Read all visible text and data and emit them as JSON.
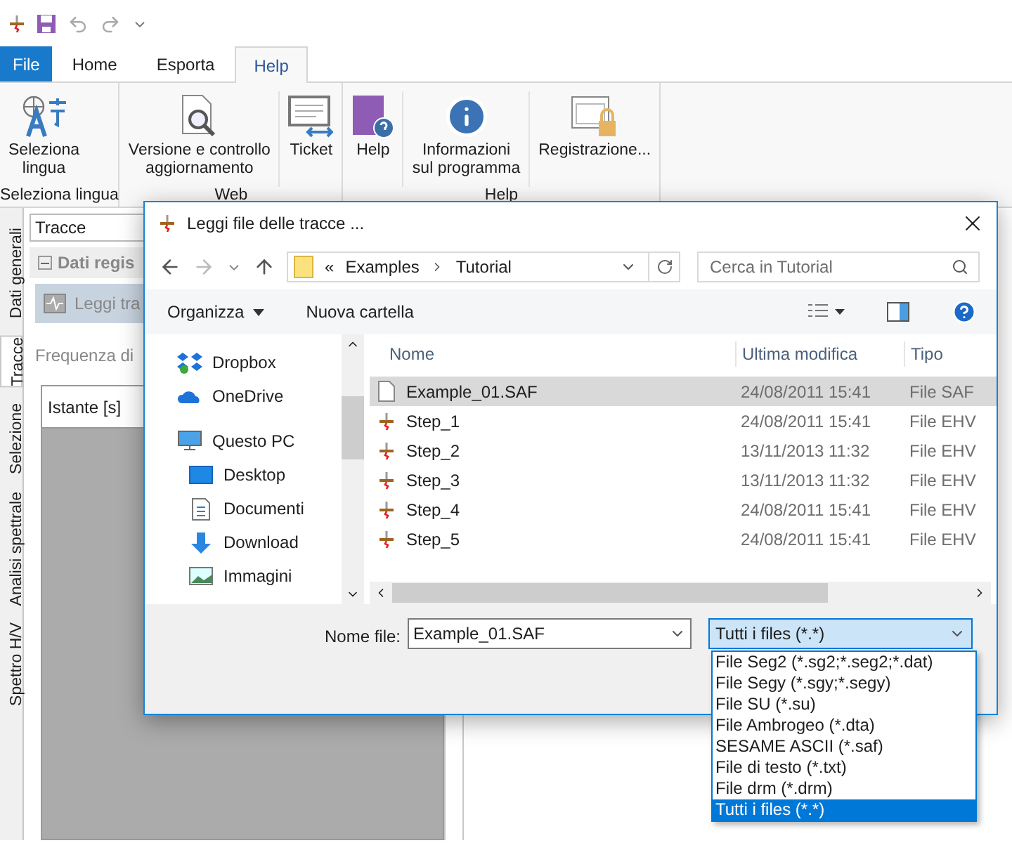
{
  "ribbon_tabs": [
    {
      "label": "File",
      "kind": "file",
      "selected": false
    },
    {
      "label": "Home",
      "kind": "tab",
      "selected": false
    },
    {
      "label": "Esporta",
      "kind": "tab",
      "selected": false
    },
    {
      "label": "Help",
      "kind": "tab",
      "selected": true
    }
  ],
  "ribbon_groups": [
    {
      "label": "Seleziona lingua",
      "buttons": [
        {
          "lines": [
            "Seleziona",
            "lingua"
          ],
          "kind": "language"
        }
      ]
    },
    {
      "label": "Web",
      "buttons": [
        {
          "lines": [
            "Versione e controllo",
            "aggiornamento"
          ],
          "kind": "version"
        },
        {
          "lines": [
            "Ticket"
          ],
          "kind": "ticket"
        }
      ]
    },
    {
      "label": "Help",
      "buttons": [
        {
          "lines": [
            "Help"
          ],
          "kind": "help"
        },
        {
          "lines": [
            "Informazioni",
            "sul programma"
          ],
          "kind": "info"
        },
        {
          "lines": [
            "Registrazione..."
          ],
          "kind": "register"
        }
      ]
    }
  ],
  "side_tabs": [
    {
      "label": "Dati generali",
      "selected": false
    },
    {
      "label": "Tracce",
      "selected": true
    },
    {
      "label": "Selezione",
      "selected": false
    },
    {
      "label": "Analisi spettrale",
      "selected": false
    },
    {
      "label": "Spettro H/V",
      "selected": false
    }
  ],
  "panel": {
    "combo": "Tracce",
    "group": "Dati regis",
    "button": "Leggi tra",
    "field_label": "Frequenza di",
    "column": "Istante [s]"
  },
  "dialog": {
    "title": "Leggi file delle tracce ...",
    "path": [
      "Examples",
      "Tutorial"
    ],
    "path_prefix": "«",
    "search": {
      "placeholder": "Cerca in Tutorial"
    },
    "toolbar": [
      "Organizza",
      "Nuova cartella"
    ],
    "nav": [
      {
        "label": "Dropbox",
        "kind": "dropbox"
      },
      {
        "label": "OneDrive",
        "kind": "onedrive"
      },
      {
        "label": "Questo PC",
        "kind": "pc",
        "children": [
          {
            "label": "Desktop",
            "kind": "desktop"
          },
          {
            "label": "Documenti",
            "kind": "documents"
          },
          {
            "label": "Download",
            "kind": "download"
          },
          {
            "label": "Immagini",
            "kind": "images"
          }
        ]
      }
    ],
    "columns": [
      "Nome",
      "Ultima modifica",
      "Tipo"
    ],
    "files": [
      {
        "name": "Example_01.SAF",
        "modified": "24/08/2011 15:41",
        "type": "File SAF",
        "kind": "document",
        "selected": true
      },
      {
        "name": "Step_1",
        "modified": "24/08/2011 15:41",
        "type": "File EHV",
        "kind": "trace",
        "selected": false
      },
      {
        "name": "Step_2",
        "modified": "13/11/2013 11:32",
        "type": "File EHV",
        "kind": "trace",
        "selected": false
      },
      {
        "name": "Step_3",
        "modified": "13/11/2013 11:32",
        "type": "File EHV",
        "kind": "trace",
        "selected": false
      },
      {
        "name": "Step_4",
        "modified": "24/08/2011 15:41",
        "type": "File EHV",
        "kind": "trace",
        "selected": false
      },
      {
        "name": "Step_5",
        "modified": "24/08/2011 15:41",
        "type": "File EHV",
        "kind": "trace",
        "selected": false
      }
    ],
    "filename_label": "Nome file:",
    "filename": "Example_01.SAF",
    "filetype": "Tutti i files (*.*)",
    "filetype_options": [
      {
        "label": "File Seg2 (*.sg2;*.seg2;*.dat)",
        "selected": false
      },
      {
        "label": "File Segy (*.sgy;*.segy)",
        "selected": false
      },
      {
        "label": "File SU (*.su)",
        "selected": false
      },
      {
        "label": "File Ambrogeo (*.dta)",
        "selected": false
      },
      {
        "label": "SESAME ASCII (*.saf)",
        "selected": false
      },
      {
        "label": "File di testo (*.txt)",
        "selected": false
      },
      {
        "label": "File drm (*.drm)",
        "selected": false
      },
      {
        "label": "Tutti i files (*.*)",
        "selected": true
      }
    ]
  }
}
